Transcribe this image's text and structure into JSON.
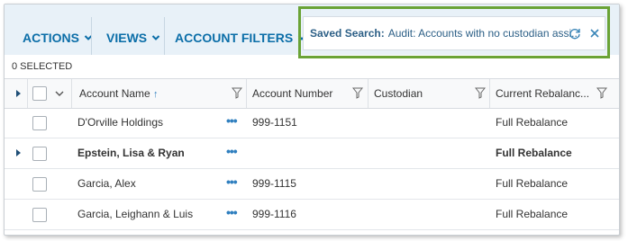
{
  "toolbar": {
    "actions_label": "ACTIONS",
    "views_label": "VIEWS",
    "filters_label": "ACCOUNT FILTERS"
  },
  "saved_search": {
    "label": "Saved Search:",
    "value": "Audit: Accounts with no custodian assi..."
  },
  "selection": {
    "count_text": "0 SELECTED"
  },
  "columns": {
    "account_name": "Account Name",
    "account_number": "Account Number",
    "custodian": "Custodian",
    "current_rebalance": "Current Rebalanc..."
  },
  "rows": [
    {
      "name": "D'Orville Holdings",
      "number": "999-1151",
      "custodian": "",
      "rebalance": "Full Rebalance",
      "bold": false,
      "expandable": false
    },
    {
      "name": "Epstein, Lisa & Ryan",
      "number": "",
      "custodian": "",
      "rebalance": "Full Rebalance",
      "bold": true,
      "expandable": true
    },
    {
      "name": "Garcia, Alex",
      "number": "999-1115",
      "custodian": "",
      "rebalance": "Full Rebalance",
      "bold": false,
      "expandable": false
    },
    {
      "name": "Garcia, Leighann & Luis",
      "number": "999-1116",
      "custodian": "",
      "rebalance": "Full Rebalance",
      "bold": false,
      "expandable": false
    }
  ],
  "colors": {
    "accent": "#0b6ea8",
    "highlight_border": "#6aa336",
    "toolbar_bg": "#e8f1f8"
  }
}
